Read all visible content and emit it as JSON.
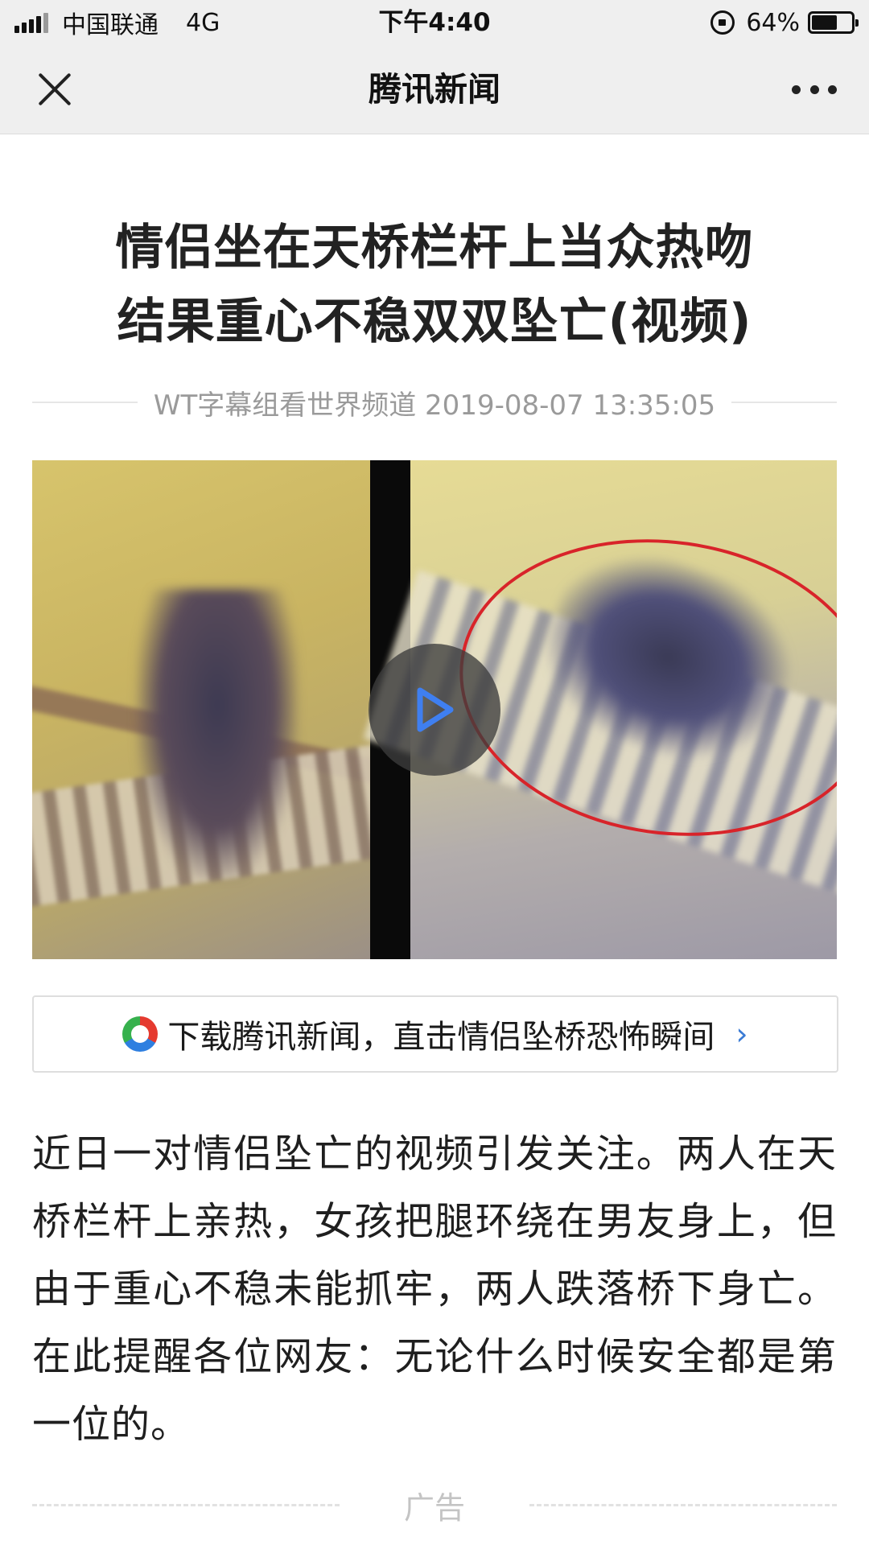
{
  "status_bar": {
    "carrier": "中国联通",
    "network": "4G",
    "time": "下午4:40",
    "battery": "64%",
    "battery_level": 0.64
  },
  "nav": {
    "title": "腾讯新闻"
  },
  "article": {
    "title_line1": "情侣坐在天桥栏杆上当众热吻",
    "title_line2": "结果重心不稳双双坠亡(视频)",
    "meta": "WT字幕组看世界频道 2019-08-07 13:35:05",
    "banner_text": "下载腾讯新闻，直击情侣坠桥恐怖瞬间",
    "body": "近日一对情侣坠亡的视频引发关注。两人在天桥栏杆上亲热，女孩把腿环绕在男友身上，但由于重心不稳未能抓牢，两人跌落桥下身亡。在此提醒各位网友：无论什么时候安全都是第一位的。"
  },
  "ad": {
    "label": "广告"
  },
  "colors": {
    "accent_blue": "#3a7bd5",
    "highlight_red": "#d8242a"
  },
  "icons": [
    "signal-icon",
    "lock-rotation-icon",
    "battery-icon",
    "close-icon",
    "more-icon",
    "play-icon",
    "tencent-news-logo",
    "chevron-right-icon"
  ]
}
